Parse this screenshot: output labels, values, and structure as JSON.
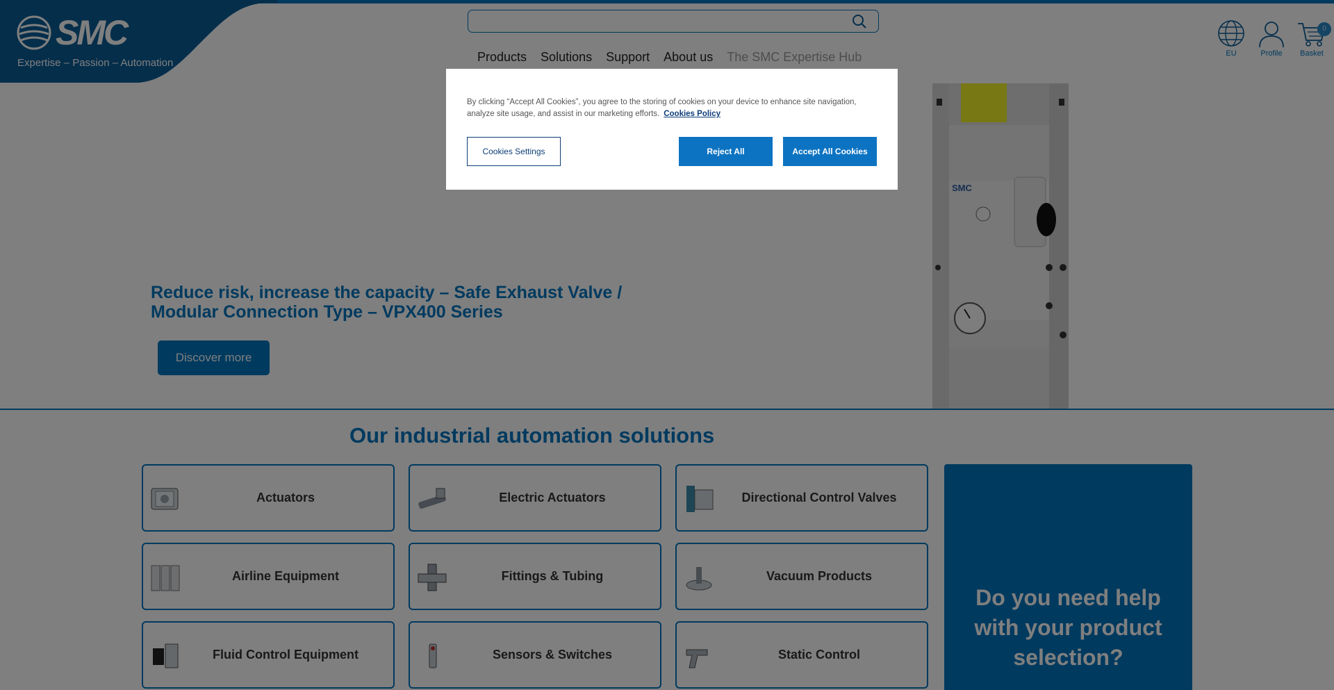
{
  "brand": {
    "logo_text": "SMC",
    "tagline": "Expertise – Passion – Automation",
    "primary_color": "#0074bf"
  },
  "search": {
    "placeholder": "",
    "icon": "search-icon"
  },
  "nav": {
    "items": [
      "Products",
      "Solutions",
      "Support",
      "About us",
      "The SMC Expertise Hub"
    ]
  },
  "utility": {
    "region_label": "EU",
    "profile_label": "Profile",
    "basket_label": "Basket",
    "basket_count": "0"
  },
  "hero": {
    "title_line1": "Reduce risk, increase the capacity – Safe Exhaust Valve /",
    "title_line2": "Modular Connection Type – VPX400 Series",
    "cta_label": "Discover more"
  },
  "solutions": {
    "title": "Our industrial automation solutions",
    "cards": [
      {
        "label": "Actuators",
        "icon": "actuator-icon"
      },
      {
        "label": "Electric Actuators",
        "icon": "electric-actuator-icon"
      },
      {
        "label": "Directional Control Valves",
        "icon": "valve-icon"
      },
      {
        "label": "Airline Equipment",
        "icon": "airline-equipment-icon"
      },
      {
        "label": "Fittings & Tubing",
        "icon": "fitting-icon"
      },
      {
        "label": "Vacuum Products",
        "icon": "vacuum-icon"
      },
      {
        "label": "Fluid Control Equipment",
        "icon": "fluid-control-icon"
      },
      {
        "label": "Sensors & Switches",
        "icon": "sensor-icon"
      },
      {
        "label": "Static Control",
        "icon": "ionizer-gun-icon"
      }
    ],
    "help_text": "Do you need help with your product selection?"
  },
  "cookie_banner": {
    "text": "By clicking “Accept All Cookies”, you agree to the storing of cookies on your device to enhance site navigation, analyze site usage, and assist in our marketing efforts.",
    "policy_link": "Cookies Policy",
    "settings_label": "Cookies Settings",
    "reject_label": "Reject All",
    "accept_label": "Accept All Cookies"
  }
}
